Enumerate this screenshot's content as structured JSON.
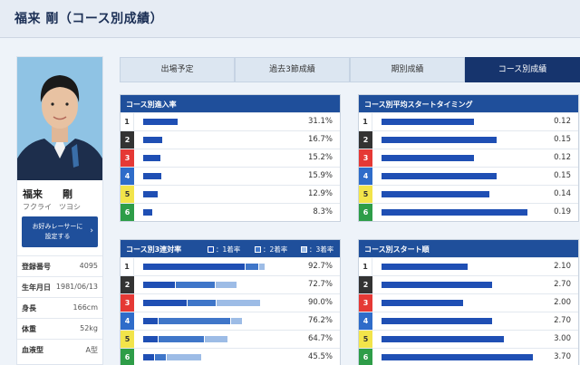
{
  "header": {
    "title": "福来 剛（コース別成績）"
  },
  "profile": {
    "name": "福来　　剛",
    "kana": "フクライ　ツヨシ",
    "fav_button": "お好みレーサーに設定する",
    "info": [
      {
        "label": "登録番号",
        "value": "4095"
      },
      {
        "label": "生年月日",
        "value": "1981/06/13"
      },
      {
        "label": "身長",
        "value": "166cm"
      },
      {
        "label": "体重",
        "value": "52kg"
      },
      {
        "label": "血液型",
        "value": "A型"
      }
    ]
  },
  "tabs": [
    {
      "label": "出場予定",
      "active": false
    },
    {
      "label": "過去3節成績",
      "active": false
    },
    {
      "label": "期別成績",
      "active": false
    },
    {
      "label": "コース別成績",
      "active": true
    }
  ],
  "colors": {
    "lane_bg": [
      "#ffffff",
      "#333333",
      "#e53935",
      "#2f6cc9",
      "#f2e44a",
      "#2e9d48"
    ],
    "lane_fg": [
      "#333333",
      "#ffffff",
      "#ffffff",
      "#ffffff",
      "#333333",
      "#ffffff"
    ],
    "bar_1": "#1f4fb4",
    "bar_2": "#3f76c9",
    "bar_3": "#9dbce6"
  },
  "panels": {
    "entry": {
      "title": "コース別進入率",
      "rows": [
        {
          "lane": "1",
          "value": "31.1%",
          "fill": 0.311
        },
        {
          "lane": "2",
          "value": "16.7%",
          "fill": 0.167
        },
        {
          "lane": "3",
          "value": "15.2%",
          "fill": 0.152
        },
        {
          "lane": "4",
          "value": "15.9%",
          "fill": 0.159
        },
        {
          "lane": "5",
          "value": "12.9%",
          "fill": 0.129
        },
        {
          "lane": "6",
          "value": "8.3%",
          "fill": 0.083
        }
      ]
    },
    "start_timing": {
      "title": "コース別平均スタートタイミング",
      "rows": [
        {
          "lane": "1",
          "value": "0.12"
        },
        {
          "lane": "2",
          "value": "0.15"
        },
        {
          "lane": "3",
          "value": "0.12"
        },
        {
          "lane": "4",
          "value": "0.15"
        },
        {
          "lane": "5",
          "value": "0.14"
        },
        {
          "lane": "6",
          "value": "0.19"
        }
      ]
    },
    "top3": {
      "title": "コース別3連対率",
      "legend": [
        "：1着率",
        "：2着率",
        "：3着率"
      ],
      "rows": [
        {
          "lane": "1",
          "value": "92.7%",
          "segments": [
            0.78,
            0.1,
            0.05
          ]
        },
        {
          "lane": "2",
          "value": "72.7%",
          "segments": [
            0.25,
            0.3,
            0.17
          ]
        },
        {
          "lane": "3",
          "value": "90.0%",
          "segments": [
            0.34,
            0.22,
            0.34
          ]
        },
        {
          "lane": "4",
          "value": "76.2%",
          "segments": [
            0.12,
            0.55,
            0.09
          ]
        },
        {
          "lane": "5",
          "value": "64.7%",
          "segments": [
            0.12,
            0.35,
            0.18
          ]
        },
        {
          "lane": "6",
          "value": "45.5%",
          "segments": [
            0.09,
            0.09,
            0.27
          ]
        }
      ]
    },
    "start_rank": {
      "title": "コース別スタート順",
      "rows": [
        {
          "lane": "1",
          "value": "2.10"
        },
        {
          "lane": "2",
          "value": "2.70"
        },
        {
          "lane": "3",
          "value": "2.00"
        },
        {
          "lane": "4",
          "value": "2.70"
        },
        {
          "lane": "5",
          "value": "3.00"
        },
        {
          "lane": "6",
          "value": "3.70"
        }
      ]
    }
  }
}
